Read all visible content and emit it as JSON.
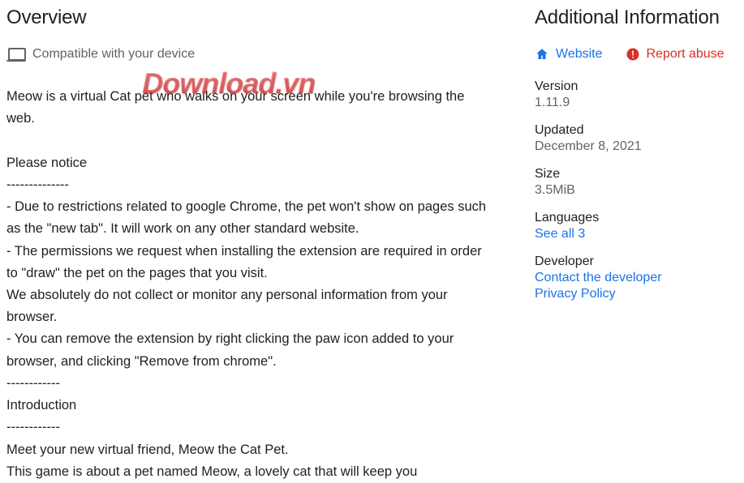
{
  "main": {
    "title": "Overview",
    "compat_label": "Compatible with your device",
    "description": "Meow is a virtual Cat pet who walks on your screen while you're browsing the web.\n\nPlease notice\n--------------\n- Due to restrictions related to google Chrome, the pet won't show on pages such as the \"new tab\". It will work on any other standard website.\n- The permissions we request when installing the extension are required in order to \"draw\" the pet on the pages that you visit.\nWe absolutely do not collect or monitor any personal information from your browser.\n- You can remove the extension by right clicking the paw icon added to your browser, and clicking \"Remove from chrome\".\n------------\nIntroduction\n------------\nMeet your new virtual friend, Meow the Cat Pet.\nThis game is about a pet named Meow, a lovely cat that will keep you"
  },
  "sidebar": {
    "title": "Additional Information",
    "website_label": "Website",
    "report_label": "Report abuse",
    "version_label": "Version",
    "version_value": "1.11.9",
    "updated_label": "Updated",
    "updated_value": "December 8, 2021",
    "size_label": "Size",
    "size_value": "3.5MiB",
    "languages_label": "Languages",
    "languages_link": "See all 3",
    "developer_label": "Developer",
    "developer_contact": "Contact the developer",
    "developer_privacy": "Privacy Policy"
  },
  "watermark": "Download.vn"
}
